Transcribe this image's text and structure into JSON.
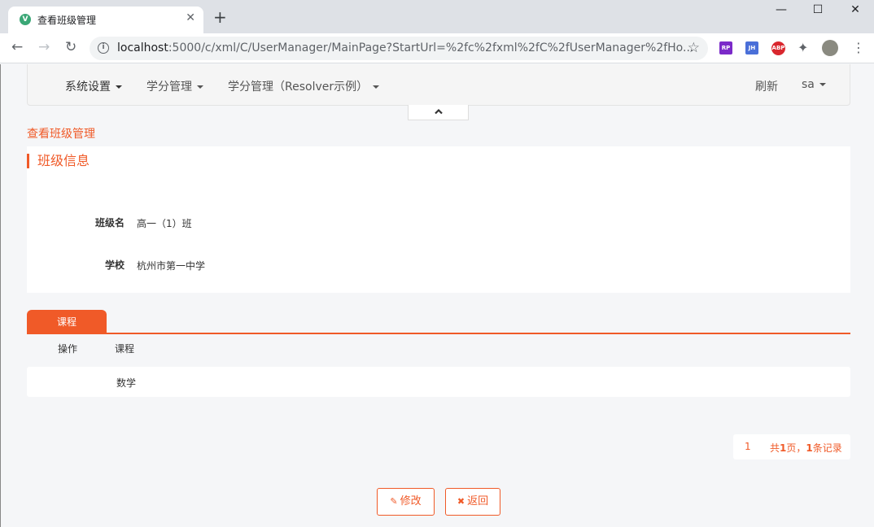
{
  "browser": {
    "tab_title": "查看班级管理",
    "favicon_letter": "V",
    "url_host": "localhost",
    "url_path": ":5000/c/xml/C/UserManager/MainPage?StartUrl=%2fc%2fxml%2fC%2fUserManager%2fHo...",
    "extensions": {
      "rp": "RP",
      "jh": "JH",
      "abp": "ABP"
    }
  },
  "navbar": {
    "items": [
      {
        "label": "系统设置"
      },
      {
        "label": "学分管理"
      },
      {
        "label": "学分管理（Resolver示例）"
      }
    ],
    "refresh_label": "刷新",
    "user_label": "sa"
  },
  "breadcrumb": "查看班级管理",
  "class_info": {
    "section_title": "班级信息",
    "fields": [
      {
        "label": "班级名",
        "value": "高一（1）班"
      },
      {
        "label": "学校",
        "value": "杭州市第一中学"
      }
    ]
  },
  "courses": {
    "tab_label": "课程",
    "columns": [
      "操作",
      "课程"
    ],
    "rows": [
      {
        "action": "",
        "course": "数学"
      }
    ]
  },
  "pager": {
    "current_page": "1",
    "summary_prefix": "共",
    "total_pages": "1",
    "summary_mid": "页，",
    "total_records": "1",
    "summary_suffix": "条记录"
  },
  "actions": {
    "edit_label": "修改",
    "back_label": "返回"
  },
  "colors": {
    "accent": "#f05a28"
  }
}
